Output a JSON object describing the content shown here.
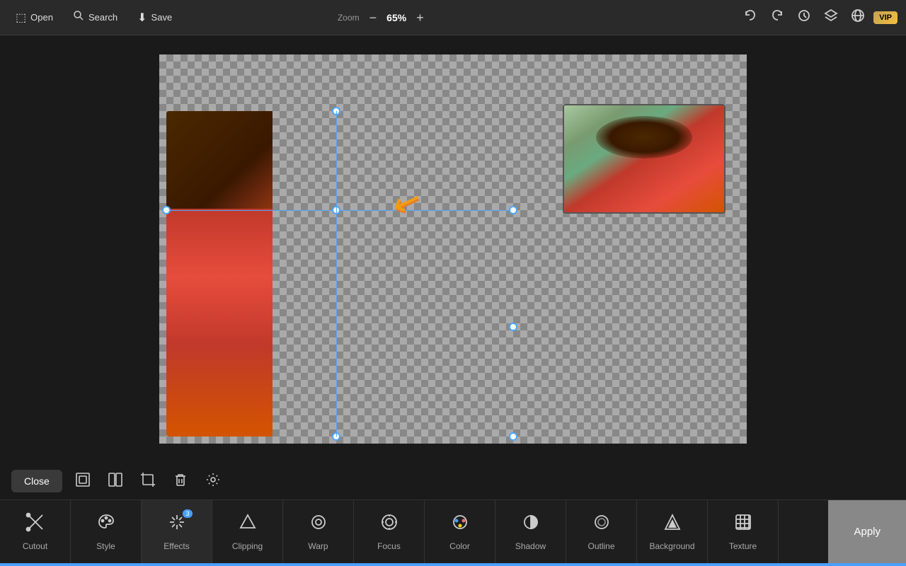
{
  "topbar": {
    "open_label": "Open",
    "search_label": "Search",
    "save_label": "Save",
    "zoom_title": "Zoom",
    "zoom_value": "65%",
    "zoom_minus": "−",
    "zoom_plus": "+",
    "vip_label": "VIP"
  },
  "toolbar": {
    "close_label": "Close"
  },
  "bottom_menu": {
    "items": [
      {
        "id": "cutout",
        "label": "Cutout",
        "icon": "scissors"
      },
      {
        "id": "style",
        "label": "Style",
        "icon": "style"
      },
      {
        "id": "effects",
        "label": "Effects",
        "icon": "effects",
        "badge": "3"
      },
      {
        "id": "clipping",
        "label": "Clipping",
        "icon": "clipping"
      },
      {
        "id": "warp",
        "label": "Warp",
        "icon": "warp"
      },
      {
        "id": "focus",
        "label": "Focus",
        "icon": "focus"
      },
      {
        "id": "color",
        "label": "Color",
        "icon": "color"
      },
      {
        "id": "shadow",
        "label": "Shadow",
        "icon": "shadow"
      },
      {
        "id": "outline",
        "label": "Outline",
        "icon": "outline"
      },
      {
        "id": "background",
        "label": "Background",
        "icon": "background"
      },
      {
        "id": "texture",
        "label": "Texture",
        "icon": "texture"
      }
    ],
    "apply_label": "Apply"
  }
}
